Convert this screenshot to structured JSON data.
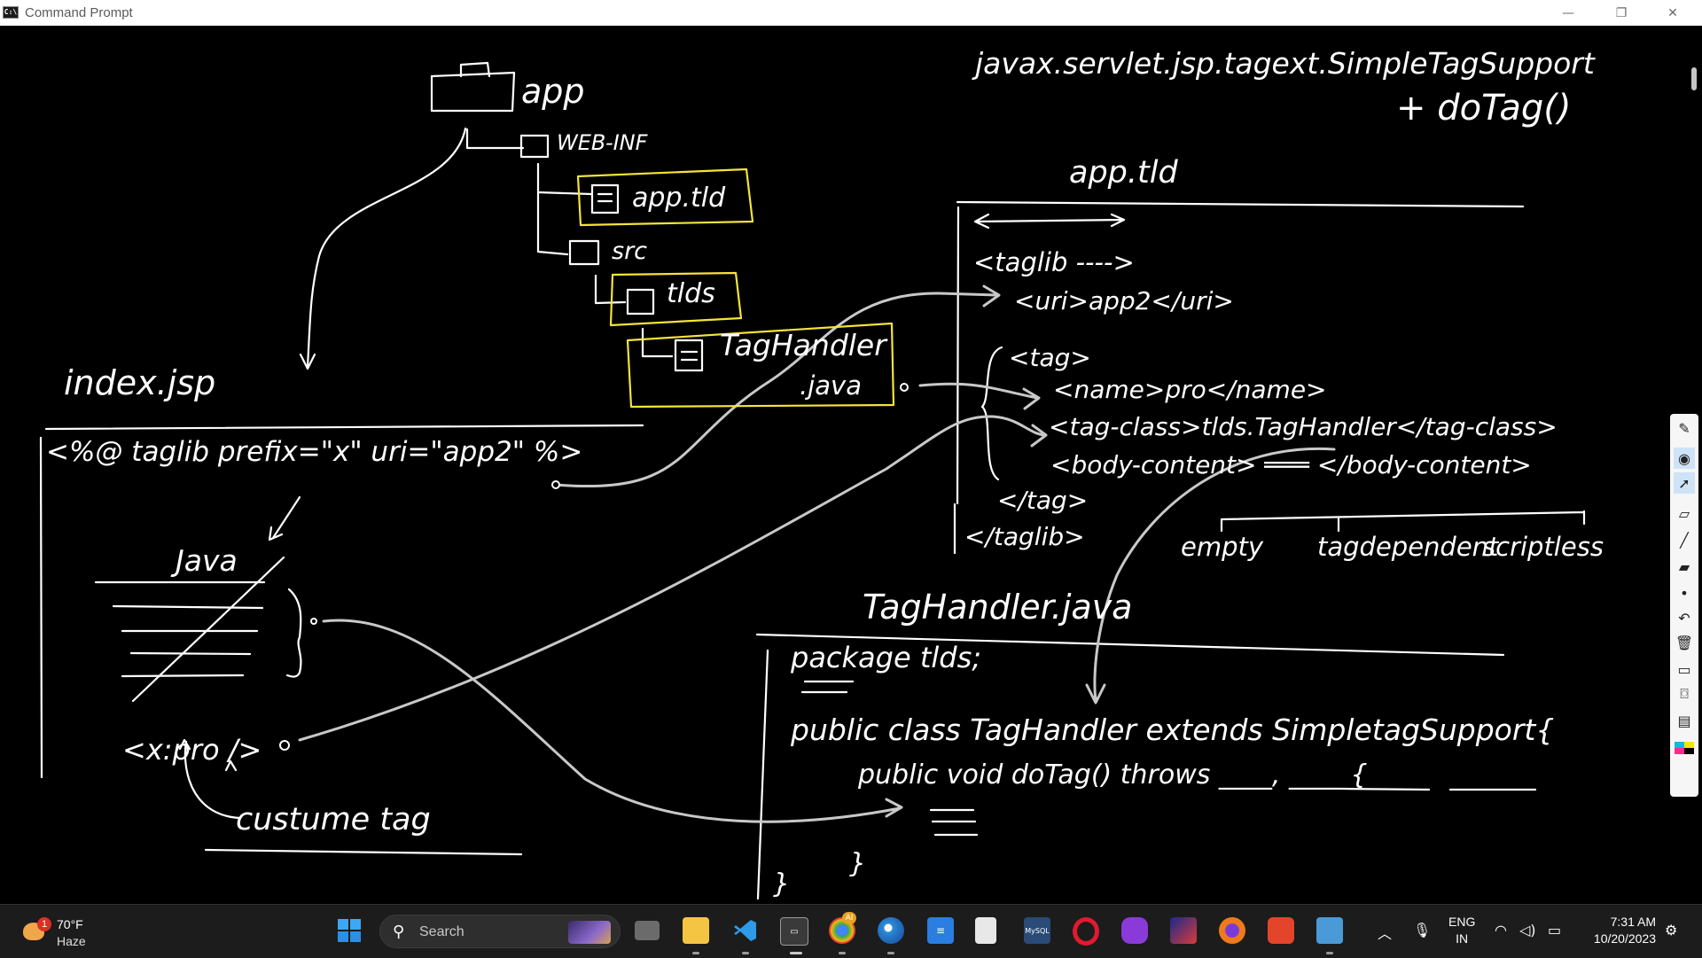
{
  "window": {
    "title": "Command Prompt",
    "app_icon_text": "C:\\",
    "minimize_icon": "minimize-icon",
    "maximize_icon": "restore-icon",
    "close_icon": "close-icon"
  },
  "whiteboard": {
    "folder_tree": {
      "root": "app",
      "web_inf": "WEB-INF",
      "app_tld": "app.tld",
      "src": "src",
      "tlds": "tlds",
      "handler_name": "TagHandler",
      "handler_ext": ".java"
    },
    "index_jsp": {
      "title": "index.jsp",
      "directive": "<%@ taglib prefix=\"x\" uri=\"app2\" %>",
      "java_label": "Java",
      "custom_tag": "<x:pro />",
      "custom_tag_caption": "custume tag"
    },
    "tld_file": {
      "heading_class": "javax.servlet.jsp.tagext.SimpleTagSupport",
      "heading_method": "+ doTag()",
      "title": "app.tld",
      "taglib_open": "<taglib ---->",
      "uri_line": "<uri>app2</uri>",
      "tag_open": "<tag>",
      "name_line": "<name>pro</name>",
      "tag_class_line": "<tag-class>tlds.TagHandler</tag-class>",
      "body_content_line": "<body-content> ═══ </body-content>",
      "tag_close": "</tag>",
      "taglib_close": "</taglib>",
      "body_options": [
        "empty",
        "tagdependent",
        "scriptless"
      ]
    },
    "taghandler_java": {
      "title": "TagHandler.java",
      "package_line": "package tlds;",
      "class_line": "public class TagHandler extends SimpletagSupport{",
      "method_line": "public void doTag() throws ____, ____ {",
      "close_inner": "}",
      "close_outer": "}"
    }
  },
  "tools": [
    "pen-icon",
    "eye-icon",
    "pointer-icon",
    "highlighter-icon",
    "line-icon",
    "eraser-icon",
    "dot-icon",
    "undo-icon",
    "trash-icon",
    "screen-icon",
    "camera-icon",
    "clipboard-icon",
    "palette-icon"
  ],
  "taskbar": {
    "weather_badge": "1",
    "weather_temp": "70°F",
    "weather_condition": "Haze",
    "search_placeholder": "Search",
    "apps": [
      "windows-start-icon",
      "task-view-icon",
      "file-explorer-icon",
      "vscode-icon",
      "terminal-icon",
      "chrome-icon",
      "paint-icon",
      "notepad-icon",
      "file-icon",
      "mysql-icon",
      "opera-icon",
      "game-icon",
      "photo-icon",
      "firefox-icon",
      "app-red-icon",
      "window-icon"
    ],
    "chrome_badge": "AI",
    "mysql_label": "MySQL",
    "language_1": "ENG",
    "language_2": "IN",
    "time": "7:31 AM",
    "date": "10/20/2023"
  }
}
